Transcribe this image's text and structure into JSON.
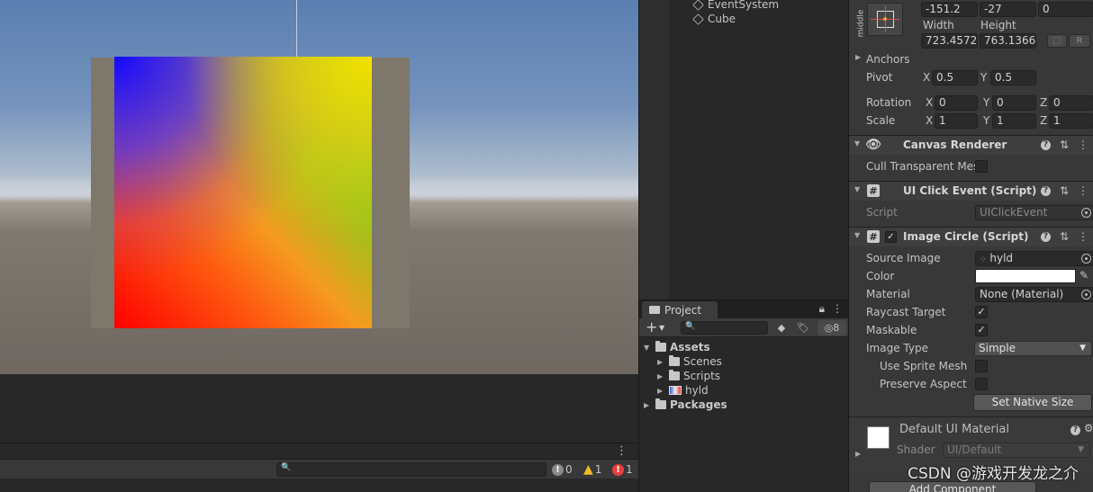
{
  "hierarchy": {
    "items": [
      {
        "label": "EventSystem"
      },
      {
        "label": "Cube"
      }
    ]
  },
  "project": {
    "tab_label": "Project",
    "hidden_count": "8",
    "tree": [
      {
        "label": "Assets"
      },
      {
        "label": "Scenes"
      },
      {
        "label": "Scripts"
      },
      {
        "label": "hyld"
      },
      {
        "label": "Packages"
      }
    ]
  },
  "console": {
    "info_count": "0",
    "warning_count": "1",
    "error_count": "1"
  },
  "inspector": {
    "rect_transform": {
      "anchor_label": "middle",
      "pos_x": "-151.2",
      "pos_y": "-27",
      "pos_z": "0",
      "width_label": "Width",
      "height_label": "Height",
      "width": "723.4572",
      "height": "763.1366",
      "r_button": "R",
      "anchors_label": "Anchors",
      "pivot_label": "Pivot",
      "pivot_x": "0.5",
      "pivot_y": "0.5",
      "rotation_label": "Rotation",
      "rot_x": "0",
      "rot_y": "0",
      "rot_z": "0",
      "scale_label": "Scale",
      "scale_x": "1",
      "scale_y": "1",
      "scale_z": "1",
      "x": "X",
      "y": "Y",
      "z": "Z"
    },
    "canvas_renderer": {
      "title": "Canvas Renderer",
      "cull_label": "Cull Transparent Mes"
    },
    "ui_click_event": {
      "title": "UI Click Event (Script)",
      "script_label": "Script",
      "script_value": "UIClickEvent"
    },
    "image_circle": {
      "title": "Image Circle (Script)",
      "source_image_label": "Source Image",
      "source_image_value": "hyld",
      "color_label": "Color",
      "color_value": "#ffffff",
      "material_label": "Material",
      "material_value": "None (Material)",
      "raycast_label": "Raycast Target",
      "maskable_label": "Maskable",
      "image_type_label": "Image Type",
      "image_type_value": "Simple",
      "use_sprite_mesh_label": "Use Sprite Mesh",
      "preserve_aspect_label": "Preserve Aspect",
      "set_native_size": "Set Native Size"
    },
    "material": {
      "title": "Default UI Material",
      "shader_label": "Shader",
      "shader_value": "UI/Default"
    },
    "add_component": "Add Component"
  },
  "watermark": "CSDN @游戏开发龙之介",
  "colors": {
    "panel": "#383838",
    "dark_panel": "#282828",
    "warning": "#f2b82a",
    "error": "#e84040"
  }
}
